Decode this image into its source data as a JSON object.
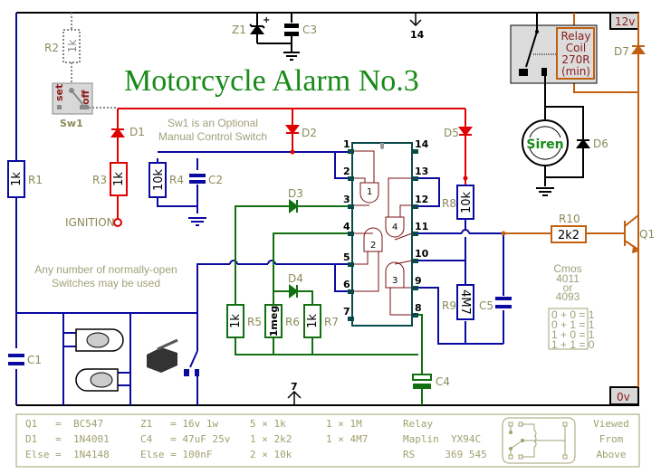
{
  "title": "Motorcycle Alarm No.3",
  "colors": {
    "ground_rail": "#000000",
    "trigger": "#0a0aa0",
    "ignition": "#e00000",
    "timing": "#127012",
    "output": "#c06010",
    "ic_outline": "#0b4a4a",
    "gates": "#7a1010",
    "label": "#8b8b5a"
  },
  "notes": {
    "sw1": [
      "Sw1 is an Optional",
      "Manual Control Switch"
    ],
    "switches": [
      "Any number of normally-open",
      "Switches may be used"
    ],
    "cmos": [
      "Cmos",
      "4011",
      "or",
      "4093"
    ],
    "truth_table": [
      "0 + 0 = 1",
      "0 + 1 = 1",
      "1 + 0 = 1",
      "1 + 1 = 0"
    ]
  },
  "rails": {
    "positive": "12v",
    "negative": "0v",
    "ignition": "IGNITION"
  },
  "switch_sw1": {
    "name": "Sw1",
    "set": "set",
    "off": "off"
  },
  "components": {
    "R1": {
      "label": "R1",
      "value": "1k"
    },
    "R2": {
      "label": "R2",
      "value": "1k"
    },
    "R3": {
      "label": "R3",
      "value": "1k"
    },
    "R4": {
      "label": "R4",
      "value": "10k"
    },
    "R5": {
      "label": "R5",
      "value": "1k"
    },
    "R6": {
      "label": "R6",
      "value": "1meg"
    },
    "R7": {
      "label": "R7",
      "value": "1k"
    },
    "R8": {
      "label": "R8",
      "value": "10k"
    },
    "R9": {
      "label": "R9",
      "value": "4M7"
    },
    "R10": {
      "label": "R10",
      "value": "2k2"
    },
    "C1": {
      "label": "C1"
    },
    "C2": {
      "label": "C2"
    },
    "C3": {
      "label": "C3"
    },
    "C4": {
      "label": "C4"
    },
    "C5": {
      "label": "C5"
    },
    "D1": {
      "label": "D1"
    },
    "D2": {
      "label": "D2"
    },
    "D3": {
      "label": "D3"
    },
    "D4": {
      "label": "D4"
    },
    "D5": {
      "label": "D5"
    },
    "D6": {
      "label": "D6"
    },
    "D7": {
      "label": "D7"
    },
    "Z1": {
      "label": "Z1"
    },
    "Q1": {
      "label": "Q1"
    },
    "siren": {
      "label": "Siren"
    },
    "relay_coil": [
      "Relay",
      "Coil",
      "270R",
      "(min)"
    ]
  },
  "ic": {
    "pins_left": [
      "1",
      "2",
      "3",
      "4",
      "5",
      "6",
      "7"
    ],
    "pins_right": [
      "14",
      "13",
      "12",
      "11",
      "10",
      "9",
      "8"
    ],
    "gates": [
      "1",
      "2",
      "3",
      "4"
    ],
    "supply_pin_top": "14",
    "supply_pin_bottom": "7"
  },
  "bom": {
    "col1": [
      "Q1   =  BC547",
      "D1   =  1N4001",
      "Else =  1N4148"
    ],
    "col2": [
      "Z1   = 16v 1w",
      "C4   = 47uF 25v",
      "Else = 100nF"
    ],
    "col3": [
      "5 × 1k",
      "1 × 2k2",
      "2 × 10k"
    ],
    "col4": [
      "1 × 1M",
      "1 × 4M7"
    ],
    "col5": [
      "Relay",
      "Maplin  YX94C",
      "RS     369 545"
    ],
    "col6": [
      "Viewed",
      "From",
      "Above"
    ]
  }
}
